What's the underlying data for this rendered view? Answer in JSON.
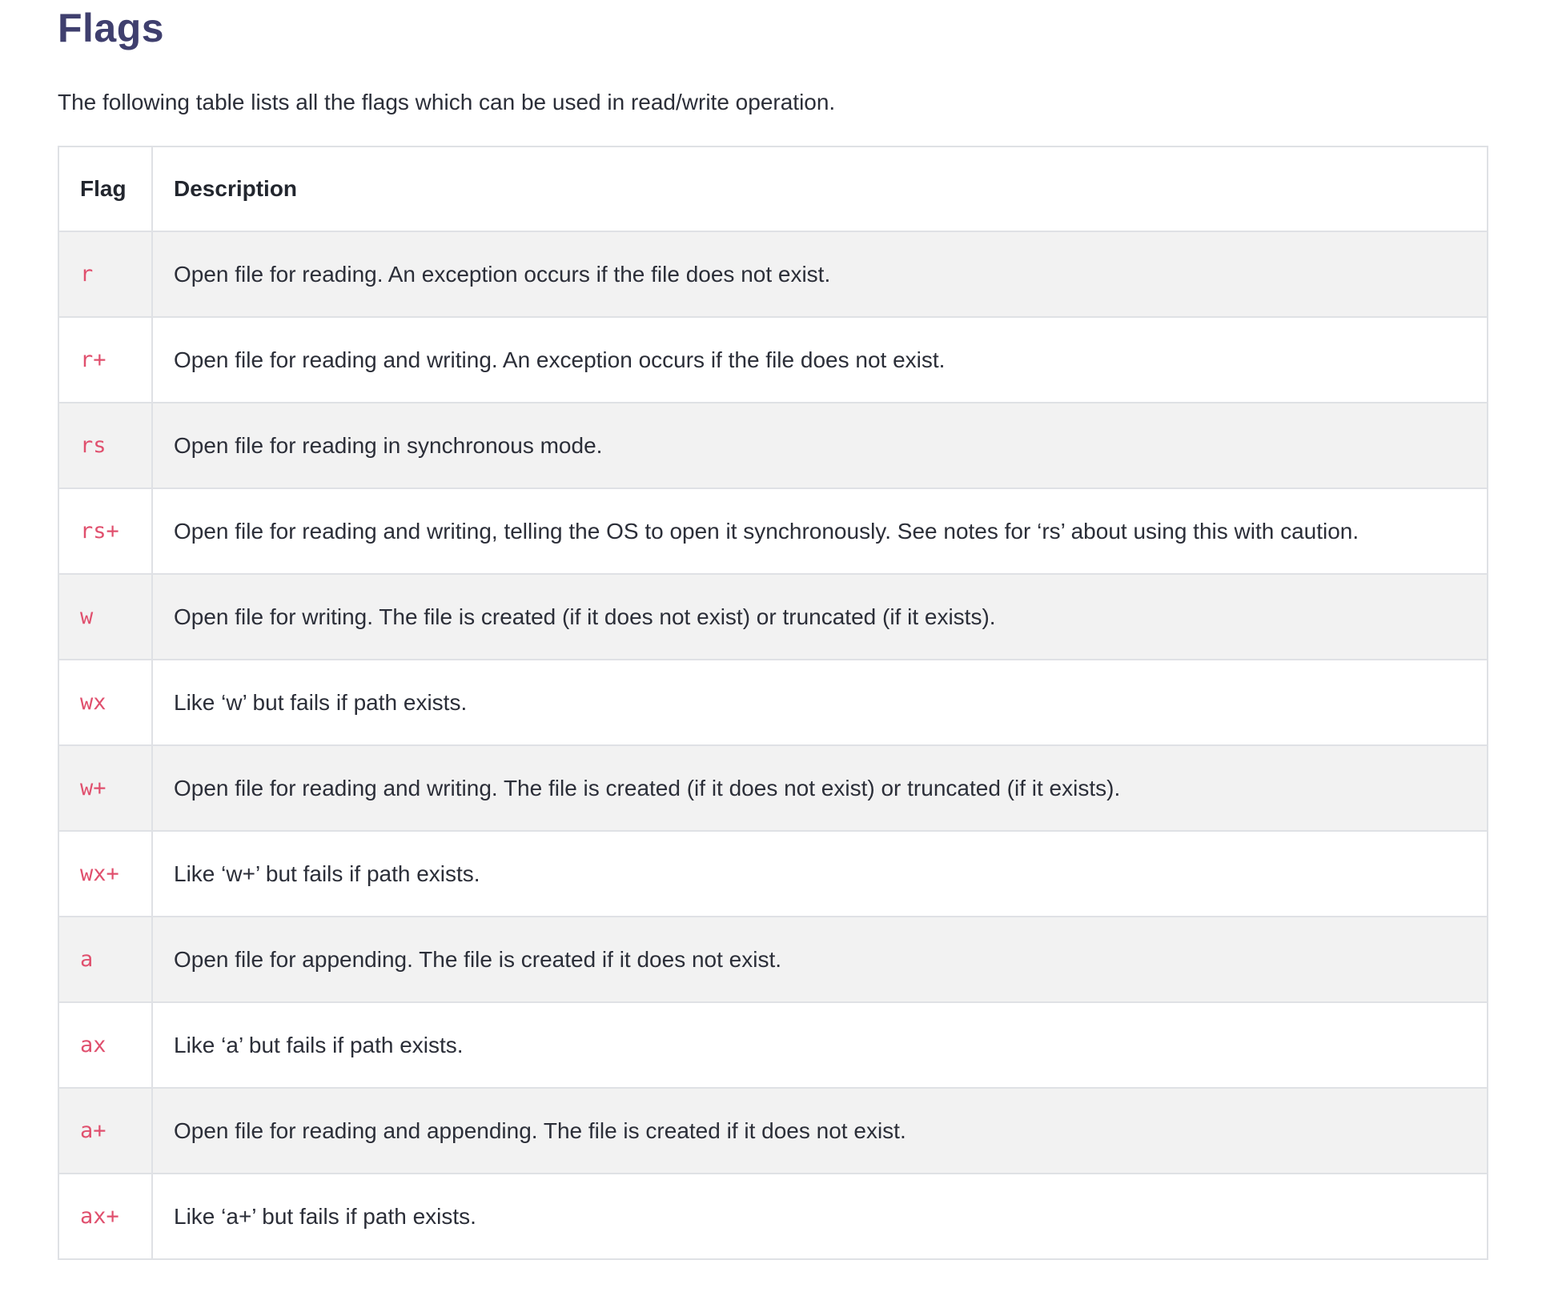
{
  "page": {
    "title": "Flags",
    "intro": "The following table lists all the flags which can be used in read/write operation."
  },
  "table": {
    "headers": [
      "Flag",
      "Description"
    ],
    "rows": [
      {
        "flag": "r",
        "description": "Open file for reading. An exception occurs if the file does not exist."
      },
      {
        "flag": "r+",
        "description": "Open file for reading and writing. An exception occurs if the file does not exist."
      },
      {
        "flag": "rs",
        "description": "Open file for reading in synchronous mode."
      },
      {
        "flag": "rs+",
        "description": "Open file for reading and writing, telling the OS to open it synchronously. See notes for ‘rs’ about using this with caution."
      },
      {
        "flag": "w",
        "description": "Open file for writing. The file is created (if it does not exist) or truncated (if it exists)."
      },
      {
        "flag": "wx",
        "description": "Like ‘w’ but fails if path exists."
      },
      {
        "flag": "w+",
        "description": "Open file for reading and writing. The file is created (if it does not exist) or truncated (if it exists)."
      },
      {
        "flag": "wx+",
        "description": "Like ‘w+’ but fails if path exists."
      },
      {
        "flag": "a",
        "description": "Open file for appending. The file is created if it does not exist."
      },
      {
        "flag": "ax",
        "description": "Like ‘a’ but fails if path exists."
      },
      {
        "flag": "a+",
        "description": "Open file for reading and appending. The file is created if it does not exist."
      },
      {
        "flag": "ax+",
        "description": "Like ‘a+’ but fails if path exists."
      }
    ]
  },
  "colors": {
    "title": "#3f3f6e",
    "flag_code": "#e0506e",
    "stripe": "#f2f2f2",
    "border": "#dfe1e5"
  }
}
